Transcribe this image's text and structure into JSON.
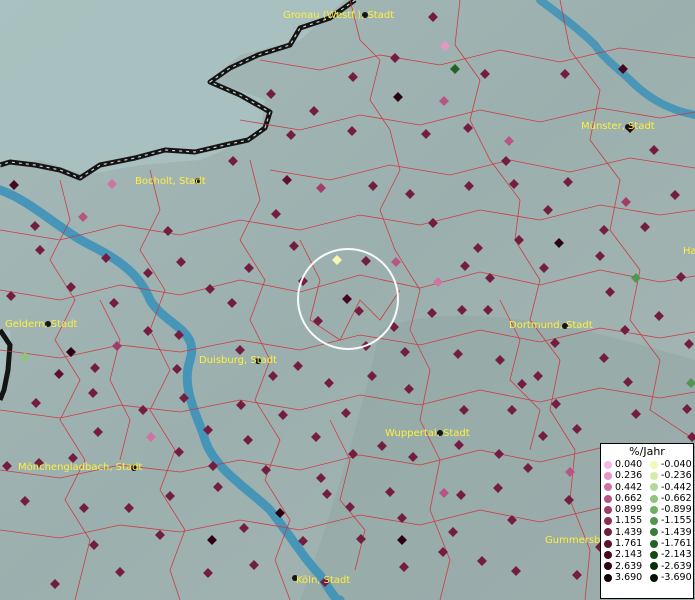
{
  "map": {
    "cities": [
      {
        "name": "Gronau (Westf.), Stadt",
        "id": "gronau"
      },
      {
        "name": "Münster, Stadt",
        "id": "muenster"
      },
      {
        "name": "Bocholt, Stadt",
        "id": "bocholt"
      },
      {
        "name": "Geldern, Stadt",
        "id": "geldern"
      },
      {
        "name": "Duisburg, Stadt",
        "id": "duisburg"
      },
      {
        "name": "Dortmund, Stadt",
        "id": "dortmund"
      },
      {
        "name": "Wuppertal, Stadt",
        "id": "wuppertal"
      },
      {
        "name": "Mönchengladbach, Stadt",
        "id": "moenchengladbach"
      },
      {
        "name": "Gummersb",
        "id": "gummersbach"
      },
      {
        "name": "Köln, Stadt",
        "id": "koeln"
      },
      {
        "name": "Ha",
        "id": "hamm"
      }
    ]
  },
  "legend": {
    "title": "%/Jahr",
    "positive": [
      {
        "label": "0.040",
        "color": "#f5b8e6"
      },
      {
        "label": "0.236",
        "color": "#e596c7"
      },
      {
        "label": "0.442",
        "color": "#cf74a2"
      },
      {
        "label": "0.662",
        "color": "#b85683"
      },
      {
        "label": "0.899",
        "color": "#a03e69"
      },
      {
        "label": "1.155",
        "color": "#8a2c54"
      },
      {
        "label": "1.439",
        "color": "#731d40"
      },
      {
        "label": "1.761",
        "color": "#5d112e"
      },
      {
        "label": "2.143",
        "color": "#45081e"
      },
      {
        "label": "2.639",
        "color": "#2e0311"
      },
      {
        "label": "3.690",
        "color": "#160006"
      }
    ],
    "negative": [
      {
        "label": "-0.040",
        "color": "#f5f7b4"
      },
      {
        "label": "-0.236",
        "color": "#d4ebaa"
      },
      {
        "label": "-0.442",
        "color": "#b1da98"
      },
      {
        "label": "-0.662",
        "color": "#8fc47f"
      },
      {
        "label": "-0.899",
        "color": "#6fae66"
      },
      {
        "label": "-1.155",
        "color": "#51964e"
      },
      {
        "label": "-1.439",
        "color": "#377d37"
      },
      {
        "label": "-1.761",
        "color": "#216424"
      },
      {
        "label": "-2.143",
        "color": "#104b14"
      },
      {
        "label": "-2.639",
        "color": "#053108"
      },
      {
        "label": "-3.690",
        "color": "#011602"
      }
    ]
  }
}
